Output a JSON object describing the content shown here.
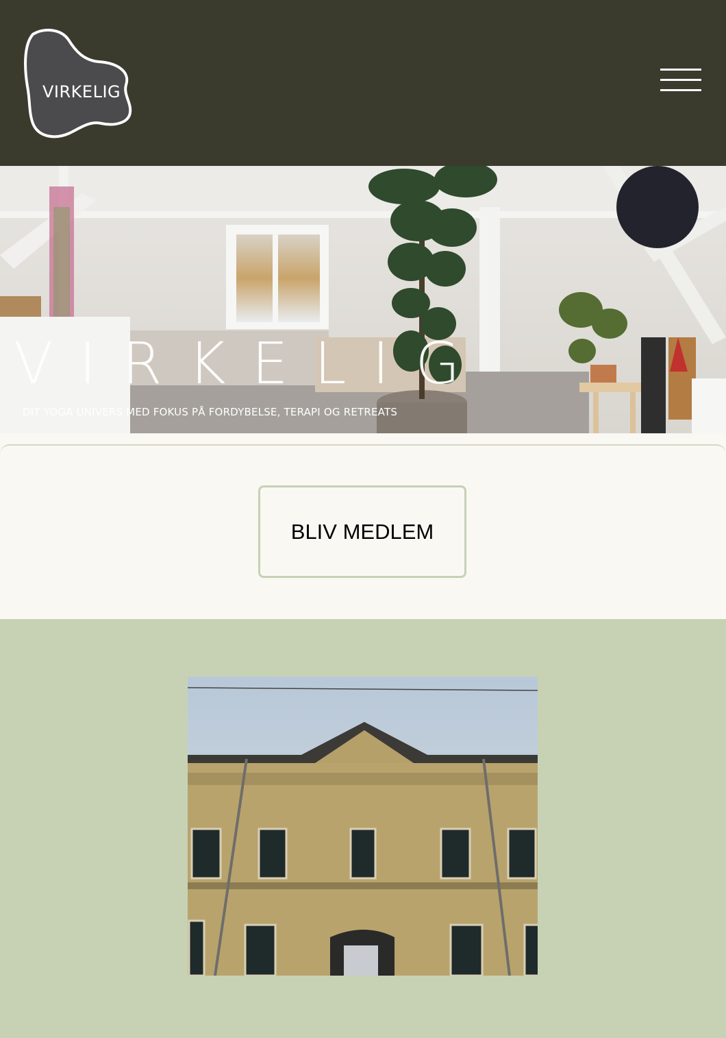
{
  "header": {
    "logo_text": "VIRKELIG",
    "menu_icon": "hamburger-menu-icon",
    "background": "#3b3b2d"
  },
  "hero": {
    "title": "VIRKELIG",
    "subtitle": "DIT YOGA UNIVERS MED FOKUS PÅ FORDYBELSE, TERAPI OG RETREATS"
  },
  "cta": {
    "label": "BLIV MEDLEM",
    "border_color": "#c6d1b6"
  },
  "image_section": {
    "background": "#c7d2b5"
  }
}
